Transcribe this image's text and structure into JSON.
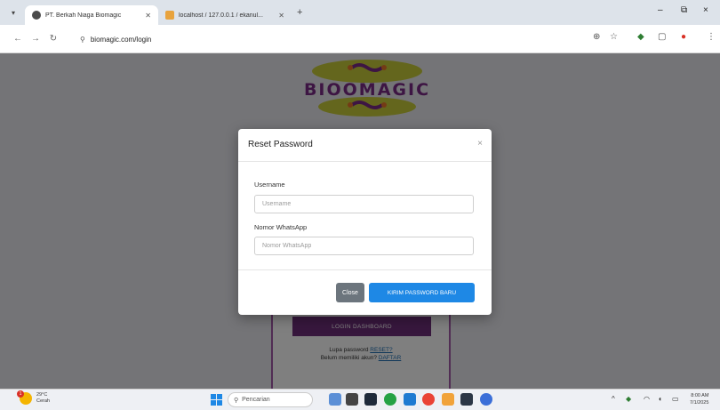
{
  "browser": {
    "tabs": [
      {
        "title": "PT. Berkah Niaga Biomagic",
        "active": true
      },
      {
        "title": "localhost / 127.0.0.1 / ekanul... ",
        "active": false
      }
    ],
    "new_tab": "+",
    "address": "biomagic.com/login",
    "window": {
      "minimize": "–",
      "maximize": "⧉",
      "close": "×"
    }
  },
  "page": {
    "logo_text": "BIOOMAGIC",
    "login_button": "LOGIN DASHBOARD",
    "forgot_text": "Lupa password",
    "forgot_link": "RESET?",
    "register_text": "Belum memiliki akun?",
    "register_link": "DAFTAR"
  },
  "modal": {
    "title": "Reset Password",
    "close_icon": "×",
    "username_label": "Username",
    "username_placeholder": "Username",
    "whatsapp_label": "Nomor WhatsApp",
    "whatsapp_placeholder": "Nomor WhatsApp",
    "close_button": "Close",
    "send_button": "KIRIM PASSWORD BARU"
  },
  "taskbar": {
    "weather_temp": "29°C",
    "weather_desc": "Cerah",
    "weather_badge": "1",
    "search_placeholder": "Pencarian",
    "time": "8:00 AM",
    "date": "7/1/2025"
  },
  "colors": {
    "primary_button": "#1e88e5",
    "secondary_button": "#6c757d",
    "brand_purple": "#6e2f7a",
    "logo_accent": "#c7c93a"
  }
}
